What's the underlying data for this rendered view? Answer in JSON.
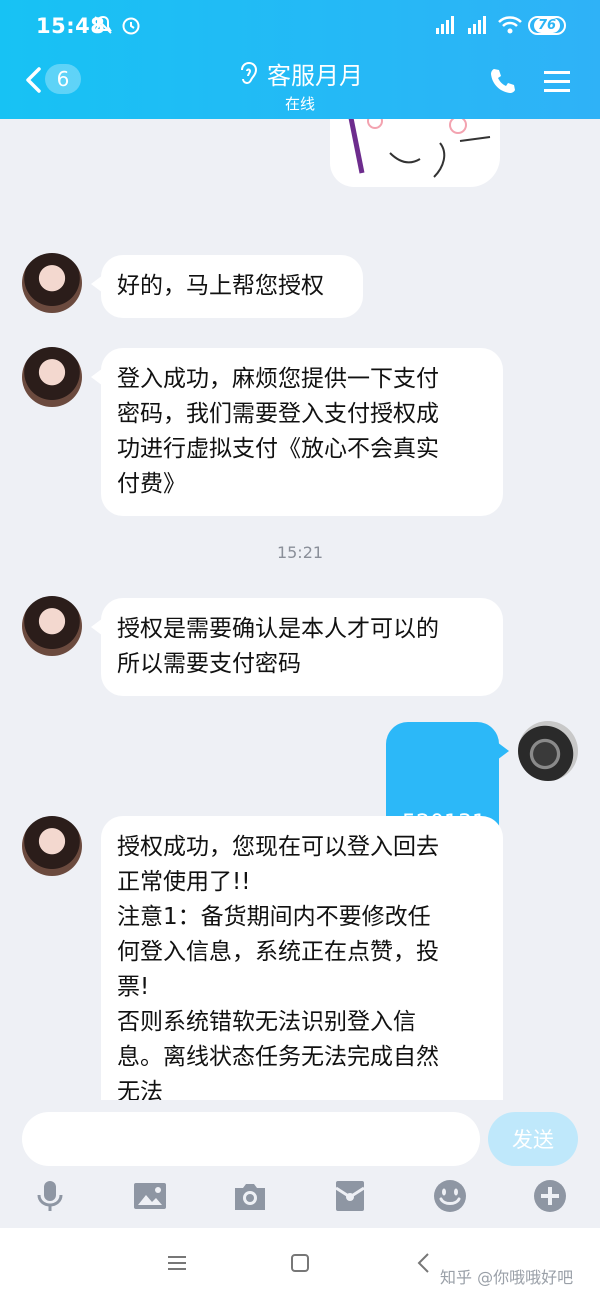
{
  "status_bar": {
    "time": "15:48",
    "battery": "76"
  },
  "header": {
    "unread_count": "6",
    "title": "客服月月",
    "subtitle": "在线"
  },
  "messages": [
    {
      "text": "好的，马上帮您授权"
    },
    {
      "text": "登入成功，麻烦您提供一下支付\n密码，我们需要登入支付授权成\n功进行虚拟支付《放心不会真实\n付费》"
    },
    {
      "timestamp": "15:21"
    },
    {
      "text": "授权是需要确认是本人才可以的\n所以需要支付密码"
    },
    {
      "text": "520131"
    },
    {
      "text": "授权成功，您现在可以登入回去\n正常使用了!!\n注意1：备货期间内不要修改任\n何登入信息，系统正在点赞，投\n票!\n否则系统错软无法识别登入信\n息。离线状态任务无法完成自然\n无法"
    }
  ],
  "input": {
    "placeholder": "",
    "send_label": "发送"
  },
  "toolbar": [
    "mic-icon",
    "image-icon",
    "camera-icon",
    "red-packet-icon",
    "emoji-icon",
    "plus-icon"
  ],
  "watermark": "知乎 @你哦哦好吧",
  "colors": {
    "header": "#1dbdf5",
    "self_bubble": "#2cb8f8",
    "background": "#eef0f5"
  }
}
